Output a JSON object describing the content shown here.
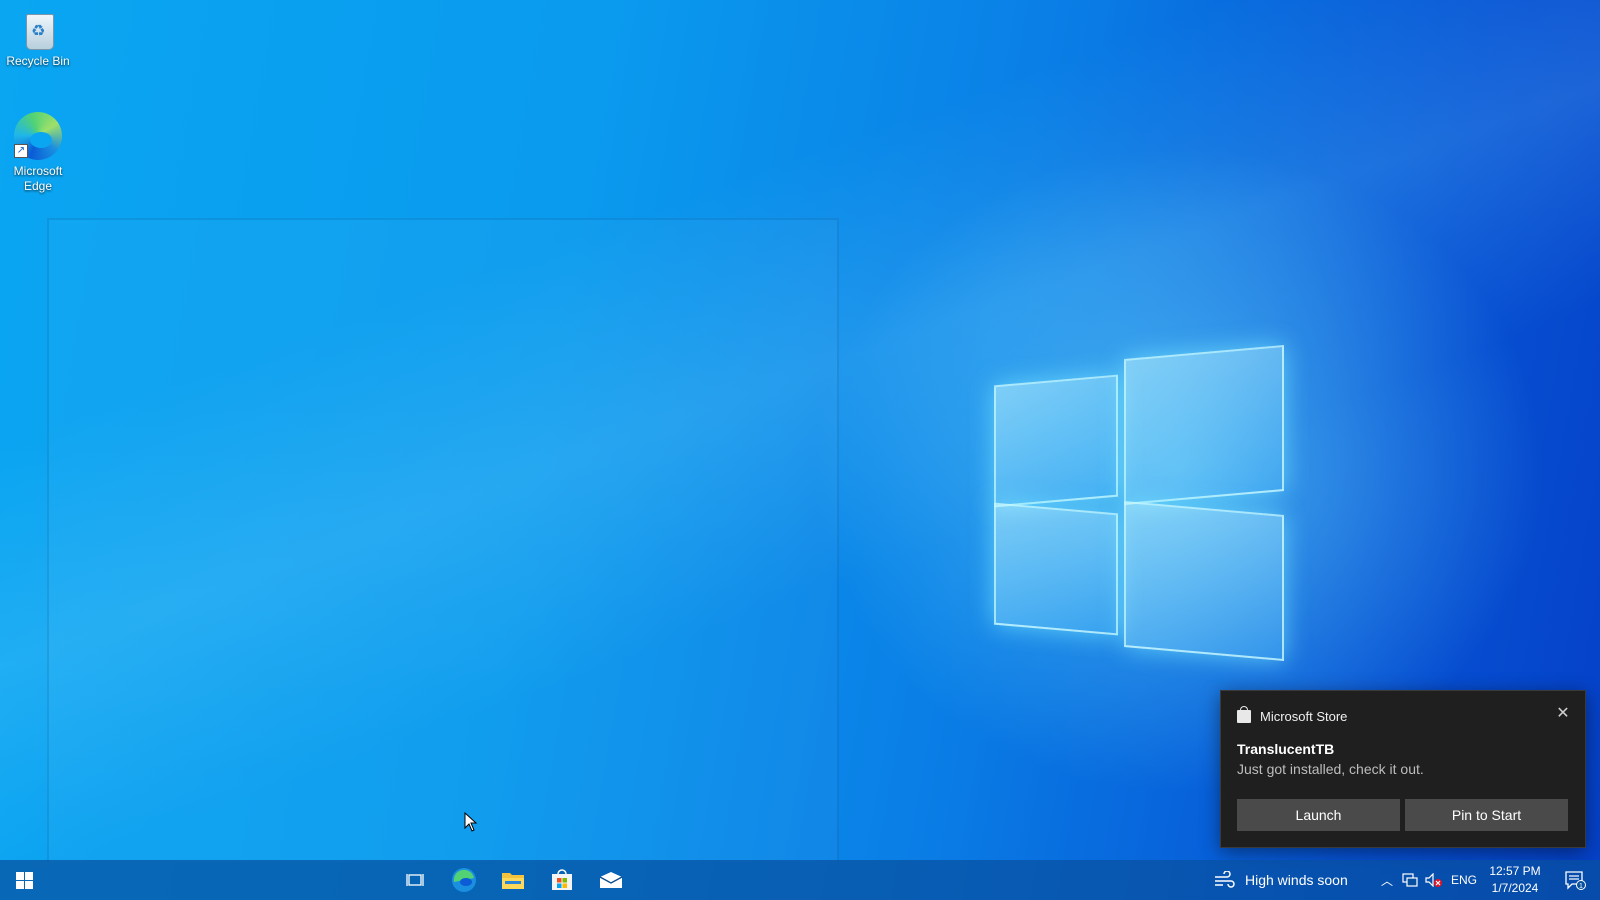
{
  "desktop": {
    "icons": [
      {
        "label": "Recycle Bin",
        "icon": "recycle-bin-icon"
      },
      {
        "label": "Microsoft Edge",
        "icon": "edge-icon"
      }
    ]
  },
  "toast": {
    "app_name": "Microsoft Store",
    "title": "TranslucentTB",
    "body": "Just got installed, check it out.",
    "buttons": {
      "launch": "Launch",
      "pin": "Pin to Start"
    },
    "close_icon": "close-icon"
  },
  "taskbar": {
    "pinned": [
      "start-icon",
      "task-view-icon",
      "edge-icon",
      "file-explorer-icon",
      "microsoft-store-icon",
      "mail-icon"
    ],
    "weather_text": "High winds soon",
    "language": "ENG",
    "time": "12:57 PM",
    "date": "1/7/2024",
    "notification_count": "1"
  },
  "colors": {
    "wallpaper": "#0a9aee",
    "toast_bg": "#1f1f1f",
    "toast_button": "#4a4a4a",
    "taskbar": "#08509f"
  }
}
